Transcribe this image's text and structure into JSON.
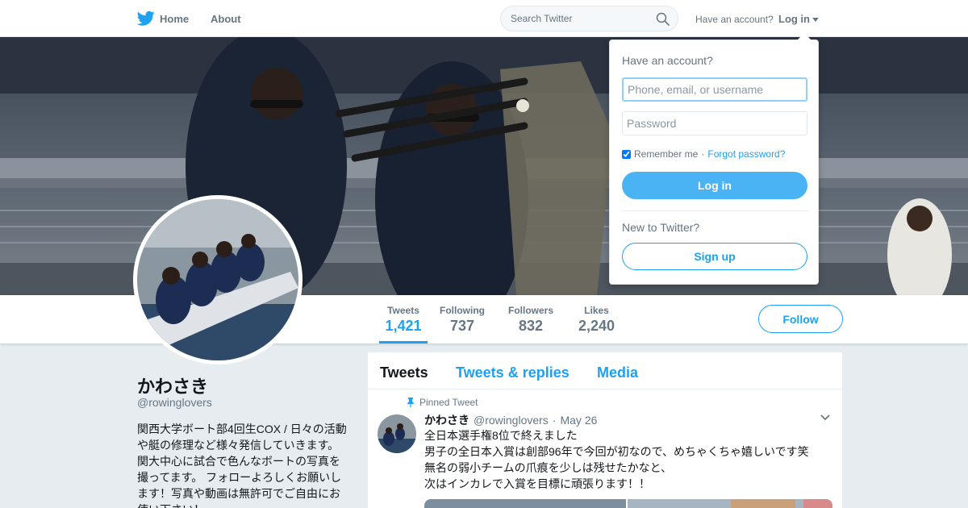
{
  "nav": {
    "home_label": "Home",
    "about_label": "About",
    "search_placeholder": "Search Twitter",
    "have_account_text": "Have an account?",
    "login_label": "Log in"
  },
  "stats": [
    {
      "label": "Tweets",
      "value": "1,421"
    },
    {
      "label": "Following",
      "value": "737"
    },
    {
      "label": "Followers",
      "value": "832"
    },
    {
      "label": "Likes",
      "value": "2,240"
    }
  ],
  "follow_label": "Follow",
  "profile": {
    "name": "かわさき",
    "handle": "@rowinglovers",
    "bio": "関西大学ボート部4回生COX / 日々の活動や艇の修理など様々発信していきます。関大中心に試合で色んなボートの写真を撮ってます。 フォローよろしくお願いします！写真や動画は無許可でご自由にお使い下さい！"
  },
  "timeline": {
    "tabs": [
      "Tweets",
      "Tweets & replies",
      "Media"
    ],
    "pinned_label": "Pinned Tweet",
    "tweet": {
      "name": "かわさき",
      "handle": "@rowinglovers",
      "date": "May 26",
      "lines": [
        "全日本選手権8位で終えました",
        "男子の全日本入賞は創部96年で今回が初なので、めちゃくちゃ嬉しいです笑",
        "無名の弱小チームの爪痕を少しは残せたかなと、",
        "次はインカレで入賞を目標に頑張ります！！"
      ]
    }
  },
  "login_dropdown": {
    "title": "Have an account?",
    "username_placeholder": "Phone, email, or username",
    "password_placeholder": "Password",
    "remember_label": "Remember me",
    "separator": "·",
    "forgot_label": "Forgot password?",
    "login_button": "Log in",
    "new_to_twitter": "New to Twitter?",
    "signup_button": "Sign up"
  },
  "colors": {
    "accent": "#1da1f2",
    "login_button_bg": "#4ab3f4",
    "page_bg": "#e6ecf0"
  }
}
